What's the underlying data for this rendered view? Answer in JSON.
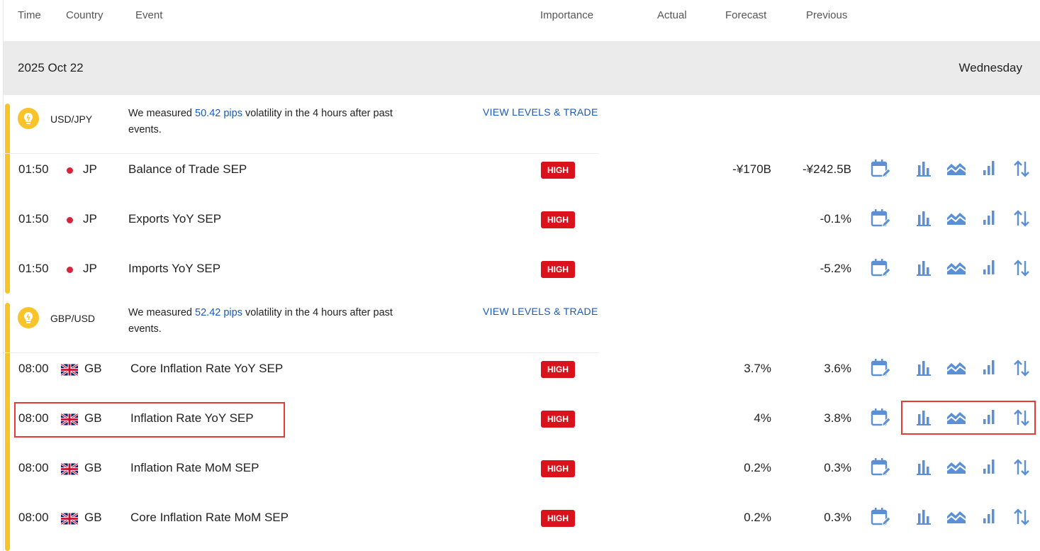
{
  "columns": {
    "time": "Time",
    "country": "Country",
    "event": "Event",
    "importance": "Importance",
    "actual": "Actual",
    "forecast": "Forecast",
    "previous": "Previous"
  },
  "date_band": {
    "date": "2025 Oct 22",
    "weekday": "Wednesday"
  },
  "groups": [
    {
      "pair": "USD/JPY",
      "vol_before": "We measured ",
      "pips": "50.42 pips",
      "vol_after": " volatility in the 4 hours after past events.",
      "link": "VIEW LEVELS & TRADE",
      "events": [
        {
          "time": "01:50",
          "country": "JP",
          "flag": "jp-flag-icon",
          "event": "Balance of Trade SEP",
          "importance": "HIGH",
          "actual": "",
          "forecast": "-¥170B",
          "previous": "-¥242.5B"
        },
        {
          "time": "01:50",
          "country": "JP",
          "flag": "jp-flag-icon",
          "event": "Exports YoY SEP",
          "importance": "HIGH",
          "actual": "",
          "forecast": "",
          "previous": "-0.1%"
        },
        {
          "time": "01:50",
          "country": "JP",
          "flag": "jp-flag-icon",
          "event": "Imports YoY SEP",
          "importance": "HIGH",
          "actual": "",
          "forecast": "",
          "previous": "-5.2%"
        }
      ]
    },
    {
      "pair": "GBP/USD",
      "vol_before": "We measured ",
      "pips": "52.42 pips",
      "vol_after": " volatility in the 4 hours after past events.",
      "link": "VIEW LEVELS & TRADE",
      "events": [
        {
          "time": "08:00",
          "country": "GB",
          "flag": "gb-flag-icon",
          "event": "Core Inflation Rate YoY SEP",
          "importance": "HIGH",
          "actual": "",
          "forecast": "3.7%",
          "previous": "3.6%"
        },
        {
          "time": "08:00",
          "country": "GB",
          "flag": "gb-flag-icon",
          "event": "Inflation Rate YoY SEP",
          "importance": "HIGH",
          "actual": "",
          "forecast": "4%",
          "previous": "3.8%"
        },
        {
          "time": "08:00",
          "country": "GB",
          "flag": "gb-flag-icon",
          "event": "Inflation Rate MoM SEP",
          "importance": "HIGH",
          "actual": "",
          "forecast": "0.2%",
          "previous": "0.3%"
        },
        {
          "time": "08:00",
          "country": "GB",
          "flag": "gb-flag-icon",
          "event": "Core Inflation Rate MoM SEP",
          "importance": "HIGH",
          "actual": "",
          "forecast": "0.2%",
          "previous": "0.3%"
        }
      ]
    }
  ],
  "row_icons": [
    "calendar-edit-icon",
    "bar-chart-icon",
    "area-chart-icon",
    "ascending-bars-icon",
    "sort-arrows-icon"
  ],
  "colors": {
    "accent_blue": "#1a59b8",
    "icon_blue": "#5b8fd6",
    "high_badge": "#d9121c",
    "group_bar": "#f9c42a",
    "date_band": "#ebebec",
    "highlight": "#e53a36"
  }
}
